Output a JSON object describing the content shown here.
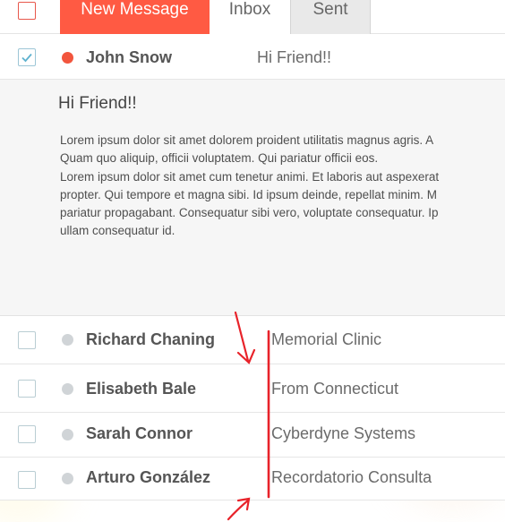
{
  "tabs": {
    "new_message": "New Message",
    "inbox": "Inbox",
    "sent": "Sent"
  },
  "open_message": {
    "sender": "John Snow",
    "subject": "Hi Friend!!",
    "title": "Hi Friend!!",
    "body_lines": [
      "Lorem ipsum dolor sit amet dolorem proident utilitatis magnus agris. A",
      "Quam quo aliquip, officii voluptatem. Qui pariatur officii eos.",
      "Lorem ipsum dolor sit amet cum tenetur animi. Et laboris aut aspexerat",
      "propter. Qui tempore et magna sibi. Id ipsum deinde, repellat minim. M",
      "pariatur propagabant. Consequatur sibi vero, voluptate consequatur. Ip",
      "ullam consequatur id."
    ]
  },
  "messages": [
    {
      "sender": "Richard Chaning",
      "subject": "Memorial Clinic"
    },
    {
      "sender": "Elisabeth Bale",
      "subject": "From Connecticut"
    },
    {
      "sender": "Sarah Connor",
      "subject": "Cyberdyne Systems"
    },
    {
      "sender": "Arturo González",
      "subject": "Recordatorio Consulta"
    }
  ],
  "colors": {
    "accent": "#ff5a43",
    "unread_dot": "#f2553d",
    "read_dot": "#d0d4d7",
    "annotation": "#e8232a"
  },
  "icons": {
    "checkmark": "check-icon"
  }
}
